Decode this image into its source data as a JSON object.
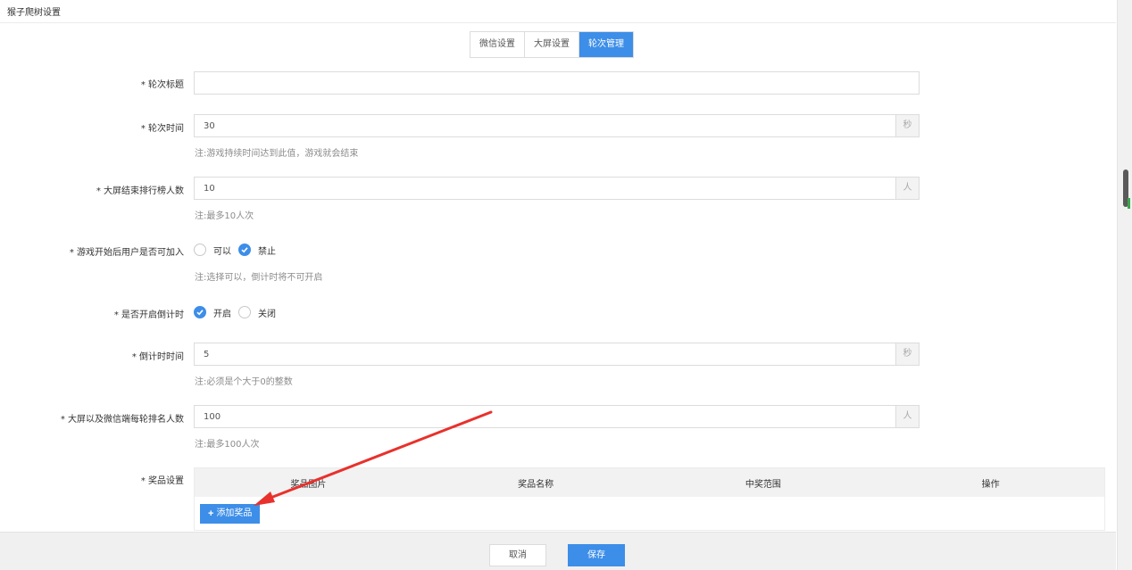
{
  "page": {
    "title": "猴子爬树设置"
  },
  "tabs": [
    {
      "label": "微信设置",
      "active": false
    },
    {
      "label": "大屏设置",
      "active": false
    },
    {
      "label": "轮次管理",
      "active": true
    }
  ],
  "form": {
    "round_title": {
      "label": "* 轮次标题",
      "value": ""
    },
    "round_time": {
      "label": "* 轮次时间",
      "value": "30",
      "unit": "秒",
      "hint": "注:游戏持续时间达到此值，游戏就会结束"
    },
    "rank_count": {
      "label": "* 大屏结束排行榜人数",
      "value": "10",
      "unit": "人",
      "hint": "注:最多10人次"
    },
    "join_after_start": {
      "label": "* 游戏开始后用户是否可加入",
      "option_yes": "可以",
      "option_no": "禁止",
      "selected": "禁止",
      "hint": "注:选择可以，倒计时将不可开启"
    },
    "countdown_enabled": {
      "label": "* 是否开启倒计时",
      "option_on": "开启",
      "option_off": "关闭",
      "selected": "开启"
    },
    "countdown_time": {
      "label": "* 倒计时时间",
      "value": "5",
      "unit": "秒",
      "hint": "注:必须是个大于0的整数"
    },
    "per_round_rank": {
      "label": "* 大屏以及微信端每轮排名人数",
      "value": "100",
      "unit": "人",
      "hint": "注:最多100人次"
    },
    "prizes": {
      "label": "* 奖品设置",
      "columns": [
        "奖品图片",
        "奖品名称",
        "中奖范围",
        "操作"
      ],
      "add_button": "添加奖品"
    }
  },
  "footer": {
    "cancel_label": "取消",
    "save_label": "保存"
  },
  "colors": {
    "primary": "#3d8ee8",
    "annotation_arrow": "#e8312c"
  }
}
